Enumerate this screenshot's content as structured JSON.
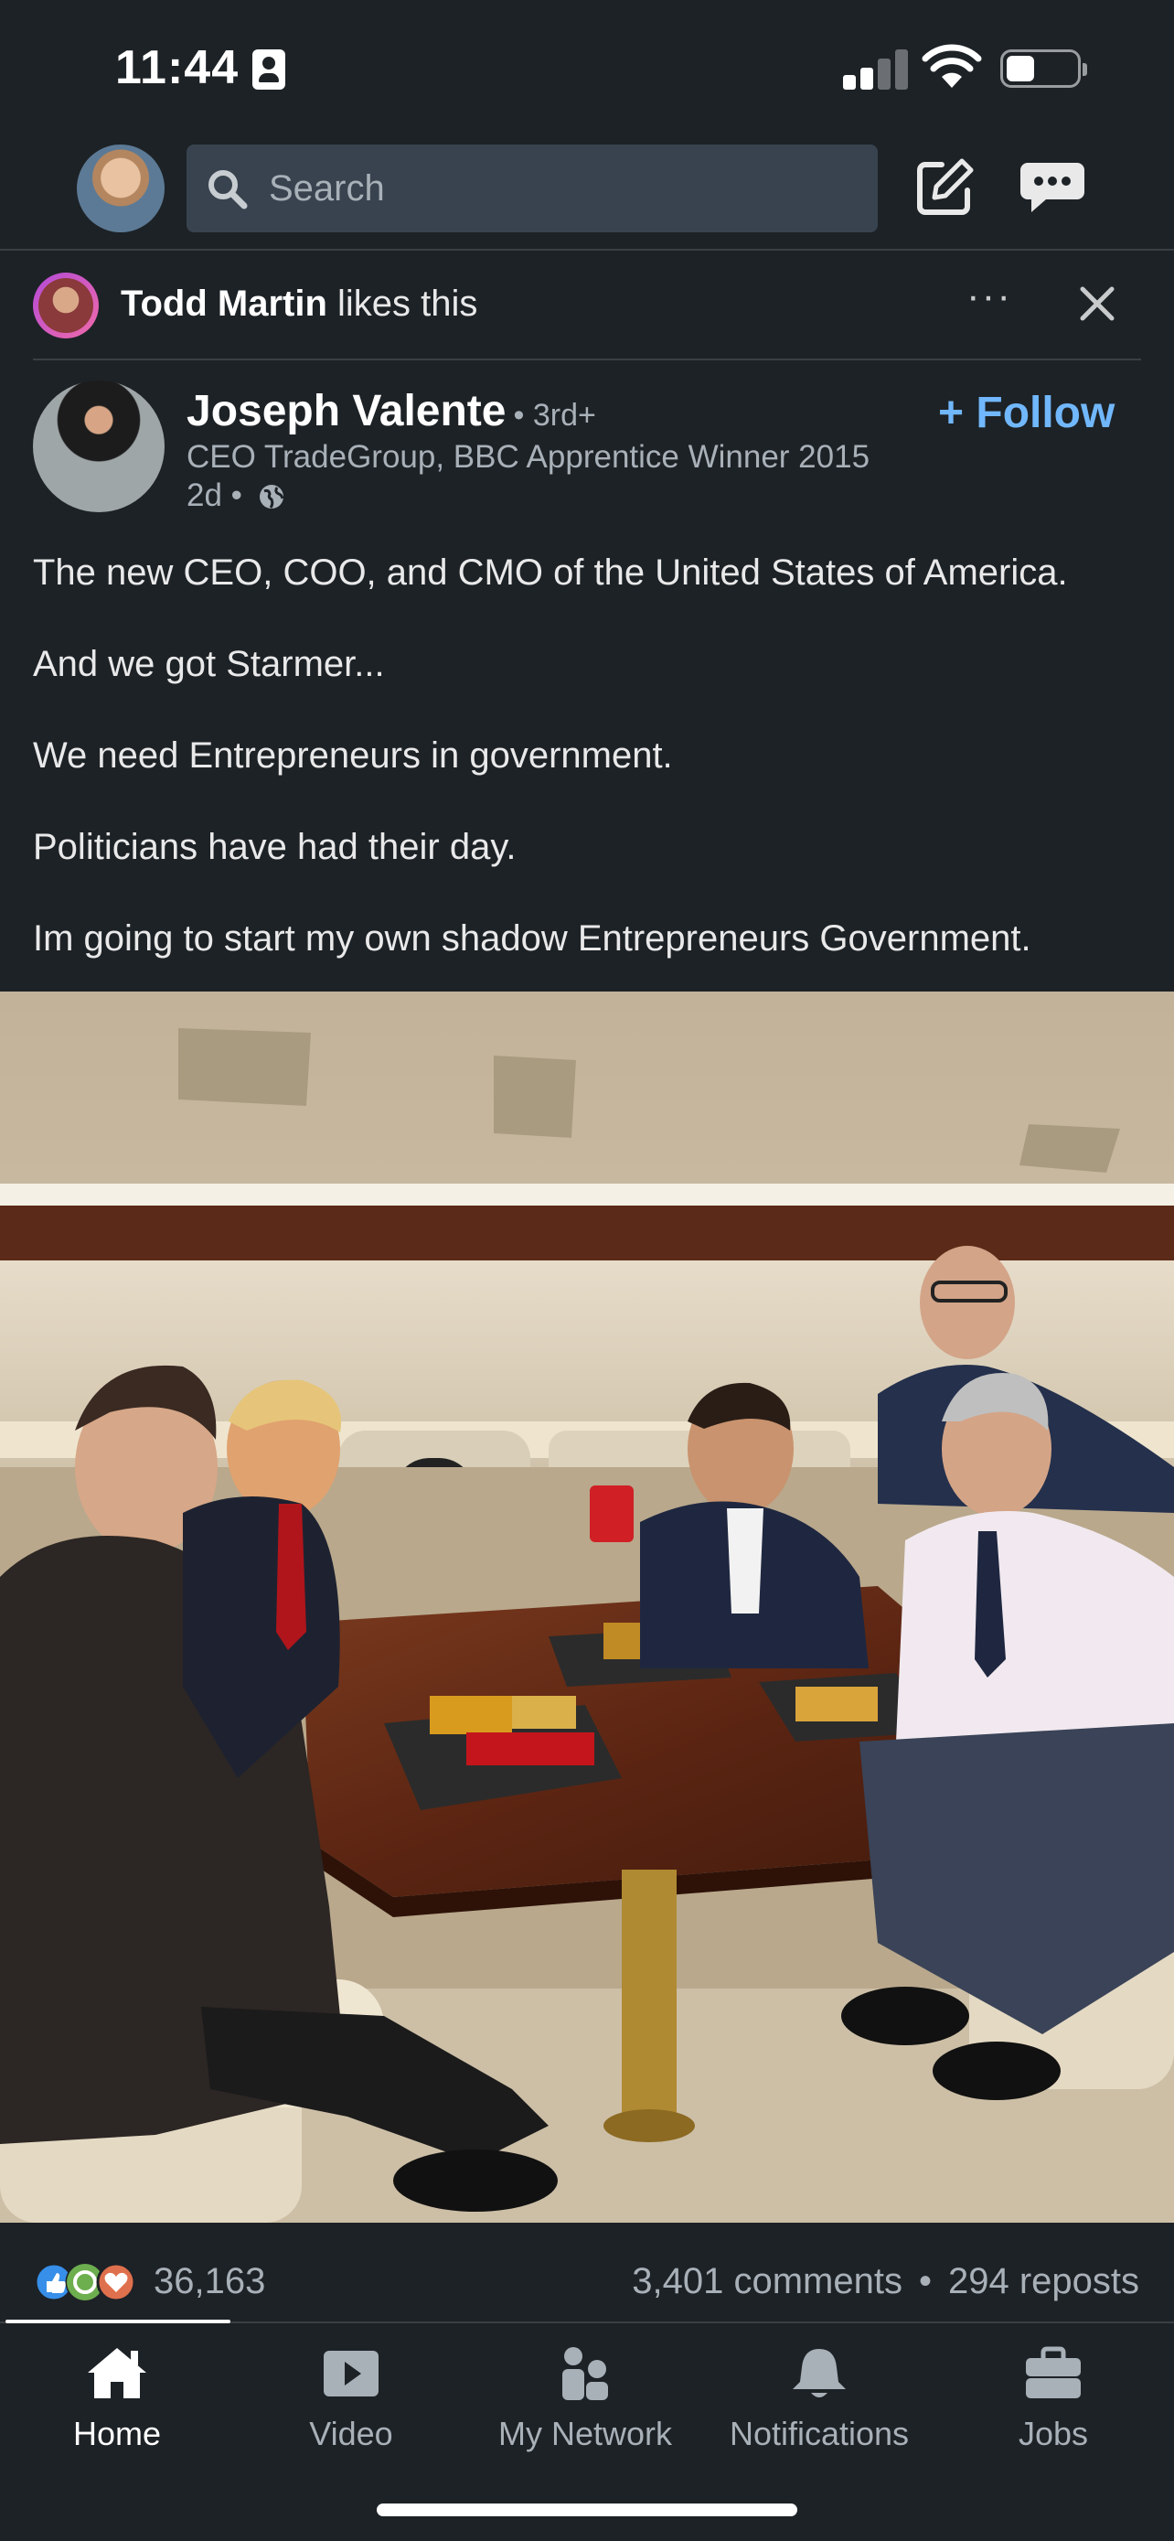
{
  "status_bar": {
    "time": "11:44"
  },
  "header": {
    "search_placeholder": "Search"
  },
  "social_context": {
    "name": "Todd Martin",
    "action": " likes this"
  },
  "post": {
    "author_name": "Joseph Valente",
    "degree": "• 3rd+",
    "headline": "CEO TradeGroup, BBC Apprentice Winner 2015",
    "time": "2d •",
    "follow_label": "+ Follow",
    "paragraphs": [
      "The new CEO, COO, and CMO of the United States of America.",
      "And we got Starmer...",
      "We need Entrepreneurs in government.",
      "Politicians have had their day.",
      "Im going to start my own shadow Entrepreneurs Government."
    ],
    "reactions_count": "36,163",
    "comments": "3,401 comments",
    "reposts": "294 reposts",
    "separator": "•"
  },
  "tabs": [
    {
      "label": "Home",
      "icon": "home-icon",
      "active": true
    },
    {
      "label": "Video",
      "icon": "video-icon",
      "active": false
    },
    {
      "label": "My Network",
      "icon": "network-icon",
      "active": false
    },
    {
      "label": "Notifications",
      "icon": "bell-icon",
      "active": false
    },
    {
      "label": "Jobs",
      "icon": "briefcase-icon",
      "active": false
    }
  ],
  "colors": {
    "background": "#1d2226",
    "accent": "#71b7fb",
    "muted_text": "#a8b0b8",
    "search_bg": "#38434f"
  }
}
